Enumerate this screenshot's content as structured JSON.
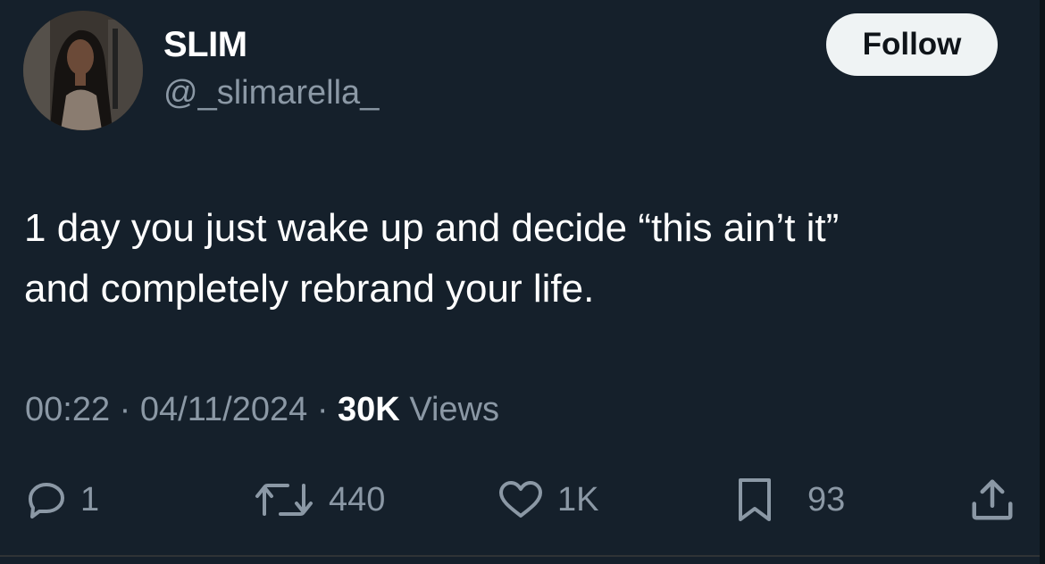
{
  "author": {
    "display_name": "SLIM",
    "handle": "@_slimarella_"
  },
  "follow_button": {
    "label": "Follow"
  },
  "tweet": {
    "text_line1": "1 day you just wake up and decide “this ain’t it”",
    "text_line2": "and completely rebrand your life."
  },
  "meta": {
    "time": "00:22",
    "separator": "·",
    "date": "04/11/2024",
    "views_count": "30K",
    "views_label": "Views"
  },
  "actions": {
    "reply": {
      "icon": "reply-icon",
      "count": "1"
    },
    "retweet": {
      "icon": "retweet-icon",
      "count": "440"
    },
    "like": {
      "icon": "heart-icon",
      "count": "1K"
    },
    "bookmark": {
      "icon": "bookmark-icon",
      "count": "93"
    },
    "share": {
      "icon": "share-icon"
    }
  },
  "colors": {
    "background": "#15202b",
    "primary_text": "#ffffff",
    "secondary_text": "#8b98a5",
    "button_bg": "#eff3f4",
    "button_text": "#0f1419"
  }
}
